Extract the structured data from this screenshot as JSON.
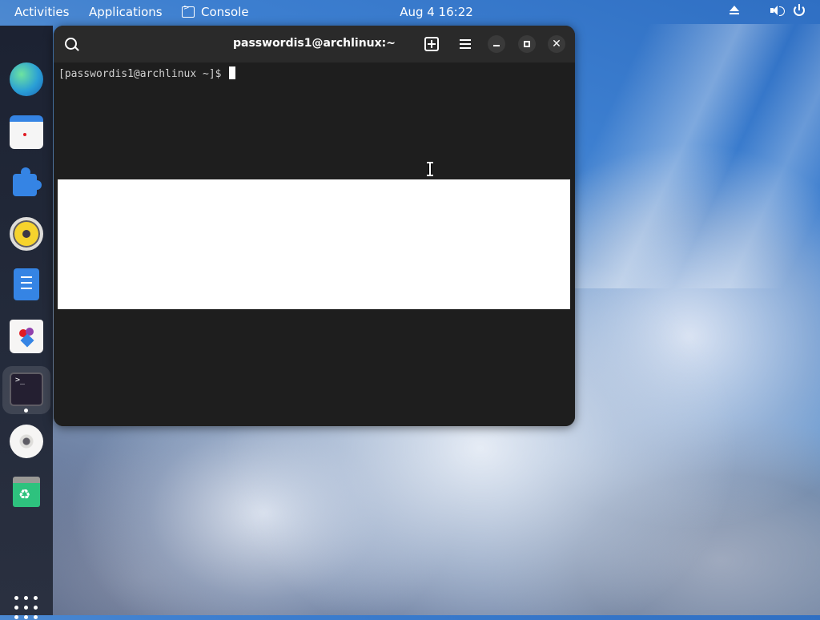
{
  "topbar": {
    "activities": "Activities",
    "applications": "Applications",
    "active_app": "Console",
    "clock": "Aug 4  16:22",
    "tray_icons": [
      "eject-icon",
      "volume-icon",
      "power-icon"
    ]
  },
  "dock": {
    "items": [
      {
        "name": "web-browser",
        "icon": "globe-icon"
      },
      {
        "name": "calendar",
        "icon": "calendar-icon"
      },
      {
        "name": "extensions",
        "icon": "puzzle-icon"
      },
      {
        "name": "rhythmbox",
        "icon": "speaker-icon"
      },
      {
        "name": "text-editor",
        "icon": "document-icon"
      },
      {
        "name": "software",
        "icon": "bag-icon"
      },
      {
        "name": "console",
        "icon": "terminal-icon",
        "running": true
      },
      {
        "name": "disc",
        "icon": "disc-icon"
      },
      {
        "name": "trash",
        "icon": "recycle-icon"
      }
    ],
    "show_apps_icon": "apps-grid-icon"
  },
  "terminal": {
    "title": "passwordis1@archlinux:~",
    "prompt": "[passwordis1@archlinux ~]$ ",
    "close_glyph": "✕"
  },
  "colors": {
    "terminal_bg": "#1e1e1e",
    "header_bg": "#2a2a2a",
    "accent": "#3584e4"
  }
}
